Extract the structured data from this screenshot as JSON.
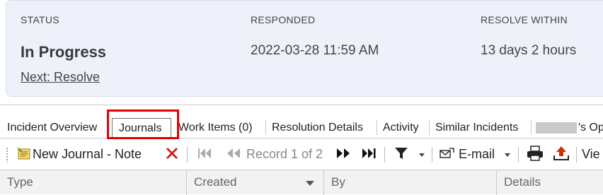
{
  "summary": {
    "status_label": "STATUS",
    "status_value": "In Progress",
    "next_link": "Next: Resolve",
    "responded_label": "RESPONDED",
    "responded_value": "2022-03-28 11:59 AM",
    "resolve_label": "RESOLVE WITHIN",
    "resolve_value": "13 days 2 hours"
  },
  "tabs": [
    {
      "label": "Incident Overview"
    },
    {
      "label": "Journals",
      "active": true
    },
    {
      "label": "Work Items (0)"
    },
    {
      "label": "Resolution Details"
    },
    {
      "label": "Activity"
    },
    {
      "label": "Similar Incidents"
    },
    {
      "label": "'s Ope"
    }
  ],
  "toolbar": {
    "new_journal": "New Journal - Note",
    "record": "Record 1 of 2",
    "email": "E-mail",
    "view": "Vie"
  },
  "grid": {
    "columns": [
      "Type",
      "Created",
      "By",
      "Details"
    ]
  },
  "colors": {
    "highlight": "#e00000",
    "card_bg": "#eef1f9",
    "delete": "#cc2222",
    "export": "#cc3300"
  }
}
